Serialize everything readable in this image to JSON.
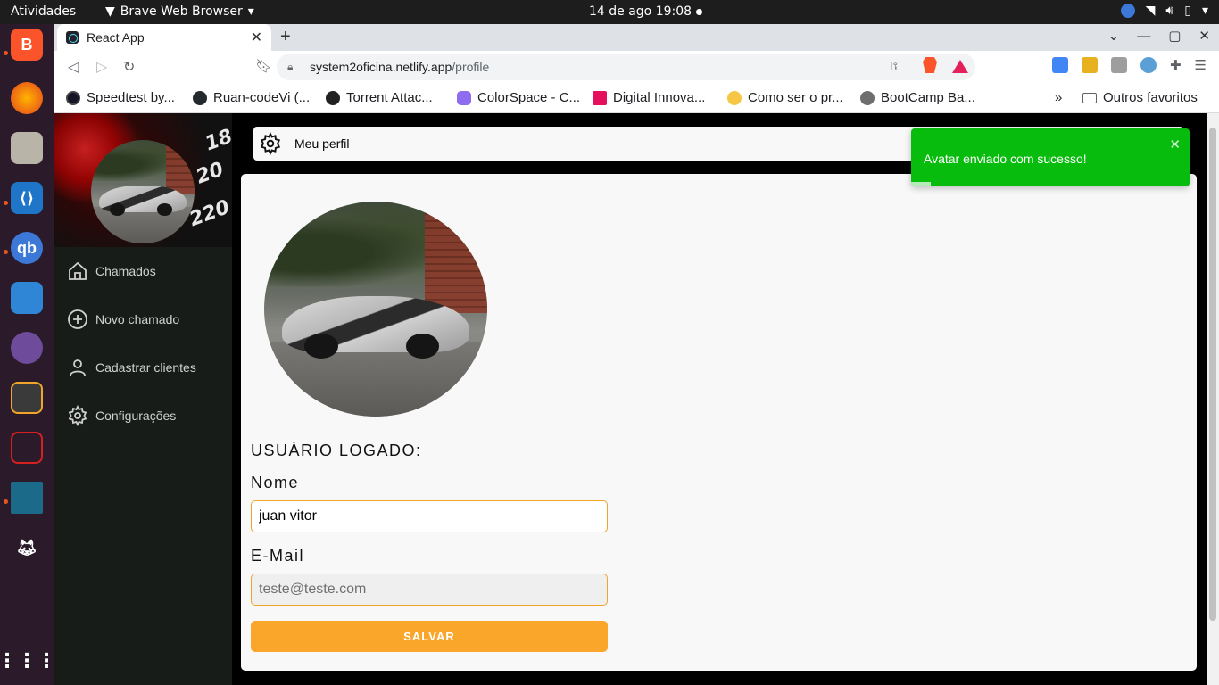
{
  "system": {
    "activities": "Atividades",
    "app_name": "Brave Web Browser",
    "clock": "14 de ago  19:08"
  },
  "browser": {
    "tab_title": "React App",
    "url_domain": "system2oficina.netlify.app",
    "url_path": "/profile",
    "bookmarks": [
      {
        "label": "Speedtest by..."
      },
      {
        "label": "Ruan-codeVi (..."
      },
      {
        "label": "Torrent Attac..."
      },
      {
        "label": "ColorSpace - C..."
      },
      {
        "label": "Digital Innova..."
      },
      {
        "label": "Como ser o pr..."
      },
      {
        "label": "BootCamp Ba..."
      }
    ],
    "other_bookmarks": "Outros favoritos"
  },
  "sidebar": {
    "items": [
      {
        "label": "Chamados",
        "icon": "home-icon"
      },
      {
        "label": "Novo chamado",
        "icon": "plus-circle-icon"
      },
      {
        "label": "Cadastrar clientes",
        "icon": "user-icon"
      },
      {
        "label": "Configurações",
        "icon": "gear-icon"
      }
    ]
  },
  "header": {
    "title": "Meu perfil"
  },
  "profile": {
    "section_title": "USUÁRIO LOGADO:",
    "name_label": "Nome",
    "name_value": "juan vitor",
    "email_label": "E-Mail",
    "email_value": "teste@teste.com",
    "save_label": "SALVAR"
  },
  "toast": {
    "message": "Avatar enviado com sucesso!",
    "progress": 0.07
  },
  "colors": {
    "accent": "#f9a62b",
    "sidebar_bg": "#181c18",
    "toast_bg": "#07bc0c"
  }
}
